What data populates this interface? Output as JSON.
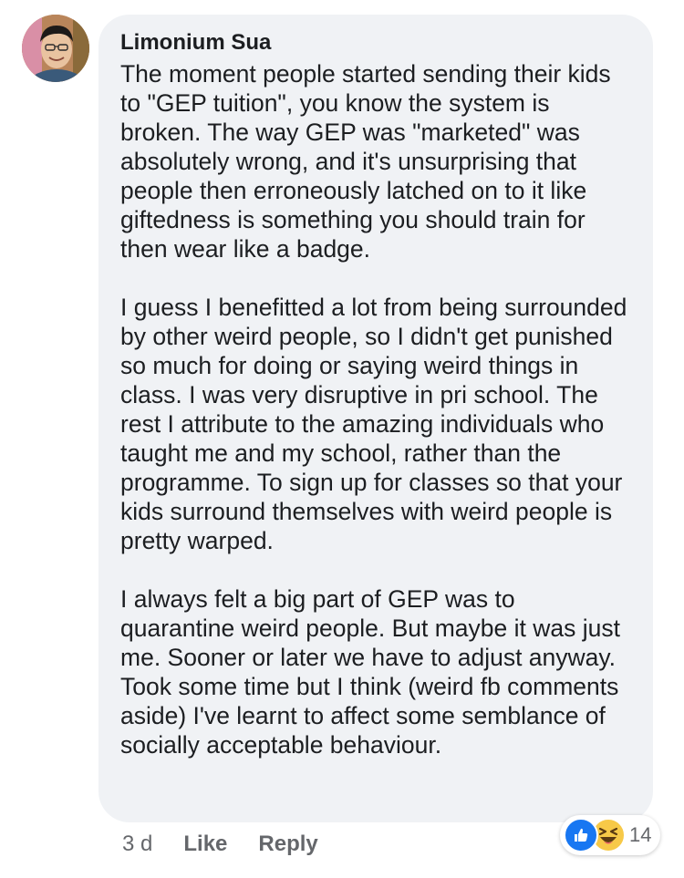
{
  "comment": {
    "author": "Limonium Sua",
    "paragraphs": [
      "The moment people started sending their kids to \"GEP tuition\", you know the system is broken. The way GEP was \"marketed\" was absolutely wrong, and it's unsurprising that people then erroneously latched on to it like giftedness is something you should train for then wear like a badge.",
      "I guess I benefitted a lot from being surrounded by other weird people, so I didn't get punished so much for doing or saying weird things in class. I was very disruptive in pri school. The rest I attribute to the amazing individuals who taught me and my school, rather than the programme. To sign up for classes so that your kids surround themselves with weird people is pretty warped.",
      "I always felt a big part of GEP was to quarantine weird people. But maybe it was just me. Sooner or later we have to adjust anyway. Took some time but I think (weird fb comments aside) I've learnt to affect some semblance of socially acceptable behaviour."
    ],
    "timestamp": "3 d",
    "like_label": "Like",
    "reply_label": "Reply",
    "reactions": {
      "icons": [
        "like-icon",
        "haha-icon"
      ],
      "count": "14"
    }
  },
  "colors": {
    "bubble_background": "#f0f2f5",
    "text": "#1c1e21",
    "secondary_text": "#65676b",
    "like_blue": "#1877f2",
    "haha_yellow": "#f7c948"
  }
}
